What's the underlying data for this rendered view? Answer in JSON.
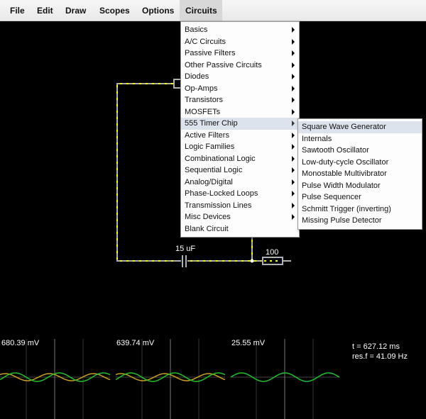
{
  "menubar": {
    "items": [
      "File",
      "Edit",
      "Draw",
      "Scopes",
      "Options",
      "Circuits"
    ]
  },
  "circuits_menu": {
    "items": [
      {
        "label": "Basics",
        "submenu": true
      },
      {
        "label": "A/C Circuits",
        "submenu": true
      },
      {
        "label": "Passive Filters",
        "submenu": true
      },
      {
        "label": "Other Passive Circuits",
        "submenu": true
      },
      {
        "label": "Diodes",
        "submenu": true
      },
      {
        "label": "Op-Amps",
        "submenu": true
      },
      {
        "label": "Transistors",
        "submenu": true
      },
      {
        "label": "MOSFETs",
        "submenu": true
      },
      {
        "label": "555 Timer Chip",
        "submenu": true,
        "selected": true
      },
      {
        "label": "Active Filters",
        "submenu": true
      },
      {
        "label": "Logic Families",
        "submenu": true
      },
      {
        "label": "Combinational Logic",
        "submenu": true
      },
      {
        "label": "Sequential Logic",
        "submenu": true
      },
      {
        "label": "Analog/Digital",
        "submenu": true
      },
      {
        "label": "Phase-Locked Loops",
        "submenu": true
      },
      {
        "label": "Transmission Lines",
        "submenu": true
      },
      {
        "label": "Misc Devices",
        "submenu": true
      },
      {
        "label": "Blank Circuit",
        "submenu": false
      }
    ]
  },
  "timer_submenu": {
    "items": [
      {
        "label": "Square Wave Generator",
        "selected": true
      },
      {
        "label": "Internals"
      },
      {
        "label": "Sawtooth Oscillator"
      },
      {
        "label": "Low-duty-cycle Oscillator"
      },
      {
        "label": "Monostable Multivibrator"
      },
      {
        "label": "Pulse Width Modulator"
      },
      {
        "label": "Pulse Sequencer"
      },
      {
        "label": "Schmitt Trigger (inverting)"
      },
      {
        "label": "Missing Pulse Detector"
      }
    ]
  },
  "circuit": {
    "capacitor_label": "15 uF",
    "resistor_label": "100"
  },
  "scopes": [
    {
      "value": "680.39 mV",
      "traces": [
        "green",
        "yellow"
      ]
    },
    {
      "value": "639.74 mV",
      "traces": [
        "green",
        "yellow"
      ]
    },
    {
      "value": "25.55 mV",
      "traces": [
        "green"
      ]
    }
  ],
  "info": {
    "time": "t = 627.12 ms",
    "res_freq": "res.f = 41.09 Hz"
  },
  "colors": {
    "wire": "#b0b0b0",
    "current_dot": "#ffff00",
    "trace_green": "#22c02a",
    "trace_yellow": "#c8a020",
    "menu_highlight": "#dde3ec"
  }
}
